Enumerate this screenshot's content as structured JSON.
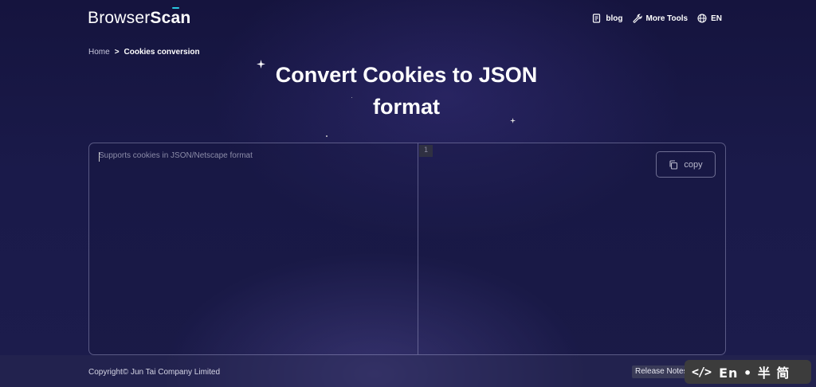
{
  "header": {
    "logo_part1": "Browser",
    "logo_part2": "Sc",
    "logo_part3": "a",
    "logo_part4": "n",
    "nav": [
      {
        "label": "blog",
        "icon": "document-icon"
      },
      {
        "label": "More Tools",
        "icon": "wrench-icon"
      },
      {
        "label": "EN",
        "icon": "globe-icon"
      }
    ]
  },
  "breadcrumb": {
    "home": "Home",
    "separator": ">",
    "current": "Cookies conversion"
  },
  "title": {
    "line1": "Convert Cookies to JSON",
    "line2": "format"
  },
  "converter": {
    "input_placeholder": "Supports cookies in JSON/Netscape format",
    "output_line_number": "1",
    "copy_label": "copy"
  },
  "footer": {
    "copyright": "Copyright© Jun Tai Company Limited",
    "release_notes": "Release Notes"
  },
  "widget": {
    "code_glyph": "</>",
    "lang_text": "En • 半 简"
  },
  "colors": {
    "background": "#1a1a4a",
    "accent": "#29c7e0"
  }
}
